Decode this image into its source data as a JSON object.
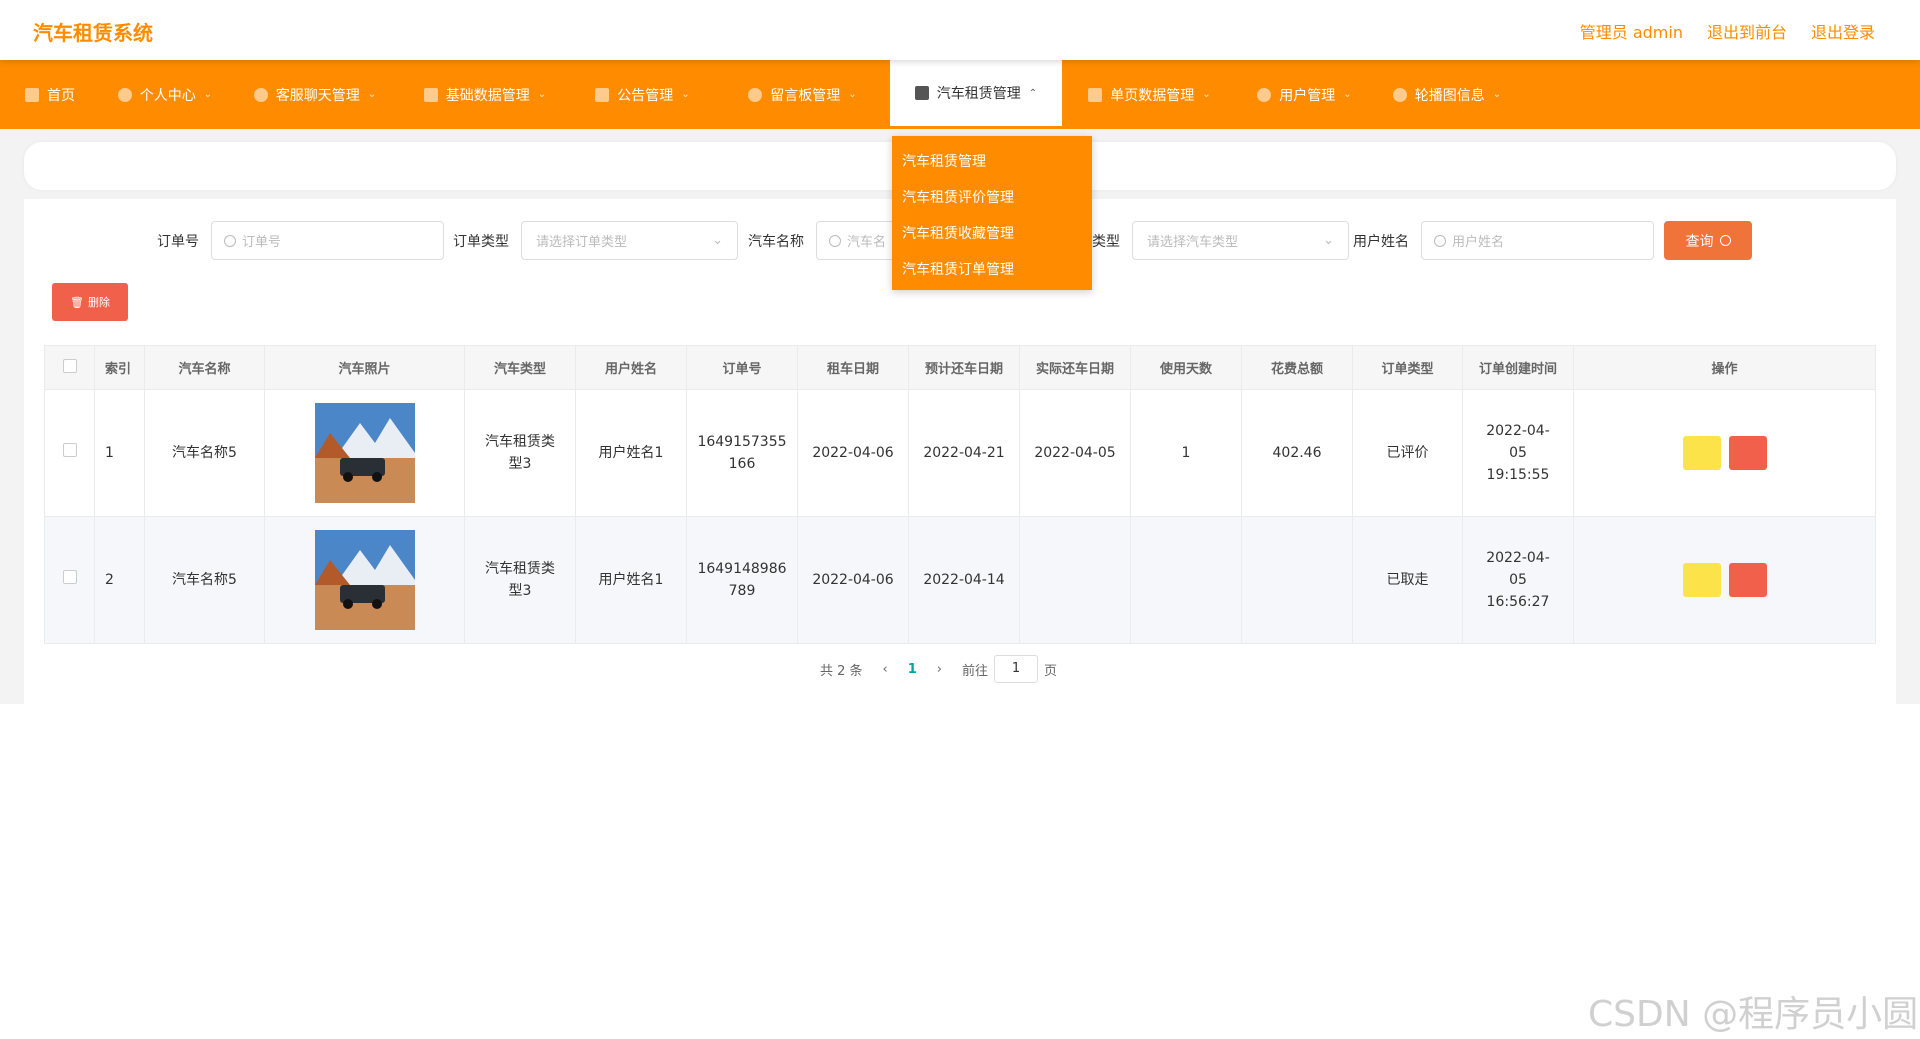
{
  "app": {
    "title": "汽车租赁系统",
    "admin_label": "管理员 admin",
    "front_link": "退出到前台",
    "logout_link": "退出登录"
  },
  "nav": [
    {
      "label": "首页",
      "icon": "home-icon"
    },
    {
      "label": "个人中心",
      "icon": "user-icon"
    },
    {
      "label": "客服聊天管理",
      "icon": "chat-icon"
    },
    {
      "label": "基础数据管理",
      "icon": "data-icon"
    },
    {
      "label": "公告管理",
      "icon": "notice-icon"
    },
    {
      "label": "留言板管理",
      "icon": "message-icon"
    },
    {
      "label": "汽车租赁管理",
      "icon": "monitor-icon",
      "active": true
    },
    {
      "label": "单页数据管理",
      "icon": "page-icon"
    },
    {
      "label": "用户管理",
      "icon": "power-icon"
    },
    {
      "label": "轮播图信息",
      "icon": "clock-icon"
    }
  ],
  "dropdown": [
    "汽车租赁管理",
    "汽车租赁评价管理",
    "汽车租赁收藏管理",
    "汽车租赁订单管理"
  ],
  "search": {
    "order_no_label": "订单号",
    "order_no_placeholder": "订单号",
    "order_type_label": "订单类型",
    "order_type_placeholder": "请选择订单类型",
    "car_name_label": "汽车名称",
    "car_name_placeholder": "汽车名",
    "car_type_label": "类型",
    "car_type_placeholder": "请选择汽车类型",
    "user_name_label": "用户姓名",
    "user_name_placeholder": "用户姓名",
    "query_label": "查询"
  },
  "delete_label": "删除",
  "table": {
    "headers": [
      "索引",
      "汽车名称",
      "汽车照片",
      "汽车类型",
      "用户姓名",
      "订单号",
      "租车日期",
      "预计还车日期",
      "实际还车日期",
      "使用天数",
      "花费总额",
      "订单类型",
      "订单创建时间",
      "操作"
    ],
    "rows": [
      {
        "index": "1",
        "car_name": "汽车名称5",
        "car_type": "汽车租赁类型3",
        "user": "用户姓名1",
        "order_no": "1649157355166",
        "rent_date": "2022-04-06",
        "expected_return": "2022-04-21",
        "actual_return": "2022-04-05",
        "days": "1",
        "total": "402.46",
        "order_type": "已评价",
        "created": "2022-04-05 19:15:55"
      },
      {
        "index": "2",
        "car_name": "汽车名称5",
        "car_type": "汽车租赁类型3",
        "user": "用户姓名1",
        "order_no": "1649148986789",
        "rent_date": "2022-04-06",
        "expected_return": "2022-04-14",
        "actual_return": "",
        "days": "",
        "total": "",
        "order_type": "已取走",
        "created": "2022-04-05 16:56:27"
      }
    ]
  },
  "pager": {
    "total": "共 2 条",
    "current": "1",
    "goto_label": "前往",
    "goto_value": "1",
    "page_unit": "页"
  },
  "watermark": "CSDN @程序员小圆",
  "colors": {
    "accent": "#ff8c00",
    "query": "#f0733a",
    "danger": "#f0604a",
    "warn": "#fce34a"
  }
}
